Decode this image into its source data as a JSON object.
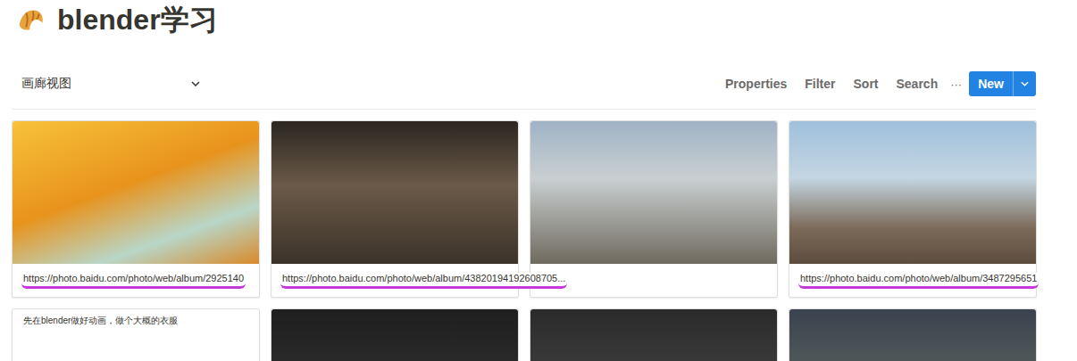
{
  "page": {
    "title": "blender学习"
  },
  "toolbar": {
    "view": "画廊视图",
    "actions": [
      "Properties",
      "Filter",
      "Sort",
      "Search"
    ],
    "more": "···",
    "new_button": "New"
  },
  "cards": [
    {
      "caption": "https://photo.baidu.com/photo/web/album/2925140",
      "cover": true,
      "annotated": true
    },
    {
      "caption": "https://photo.baidu.com/photo/web/album/43820194192608705...",
      "cover": true,
      "annotated": true
    },
    {
      "caption": "",
      "cover": true,
      "annotated": false
    },
    {
      "caption": "https://photo.baidu.com/photo/web/album/3487295651",
      "cover": true,
      "annotated": true
    },
    {
      "caption": "先在blender做好动画，做个大概的衣服",
      "cover": false,
      "annotated": false
    },
    {
      "caption": "",
      "cover": true,
      "annotated": false
    },
    {
      "caption": "",
      "cover": true,
      "annotated": false
    },
    {
      "caption": "",
      "cover": true,
      "annotated": false
    }
  ]
}
